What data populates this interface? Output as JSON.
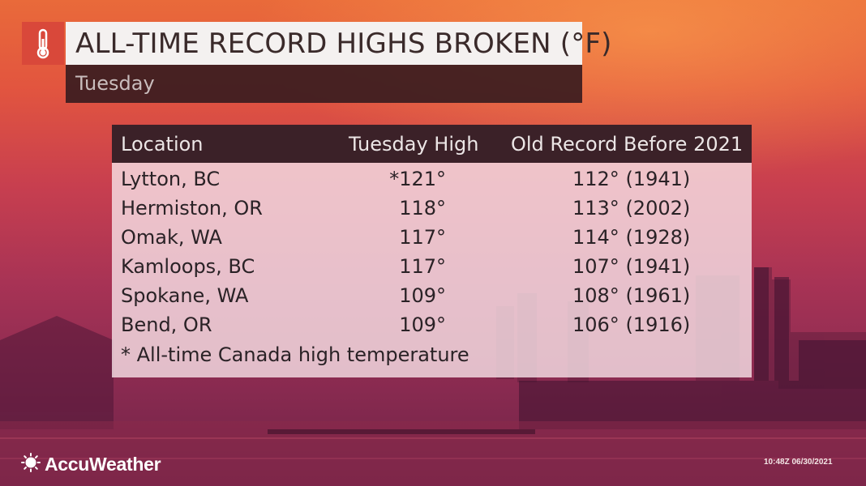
{
  "title": "ALL-TIME RECORD HIGHS BROKEN (°F)",
  "subtitle": "Tuesday",
  "table": {
    "headers": {
      "location": "Location",
      "high": "Tuesday High",
      "old_record": "Old Record Before 2021"
    },
    "rows": [
      {
        "location": "Lytton, BC",
        "high": "*121°",
        "old_record": "112° (1941)"
      },
      {
        "location": "Hermiston, OR",
        "high": "118°",
        "old_record": "113° (2002)"
      },
      {
        "location": "Omak, WA",
        "high": "117°",
        "old_record": "114° (1928)"
      },
      {
        "location": "Kamloops, BC",
        "high": "117°",
        "old_record": "107° (1941)"
      },
      {
        "location": "Spokane, WA",
        "high": "109°",
        "old_record": "108° (1961)"
      },
      {
        "location": "Bend, OR",
        "high": "109°",
        "old_record": "106° (1916)"
      }
    ],
    "footnote": "* All-time Canada high temperature"
  },
  "brand": {
    "name": "AccuWeather",
    "icon": "sun-icon"
  },
  "timestamp": "10:48Z 06/30/2021",
  "icons": {
    "title_icon": "thermometer-icon"
  },
  "colors": {
    "accent": "#d9483a",
    "header_bg": "#3b2128"
  }
}
